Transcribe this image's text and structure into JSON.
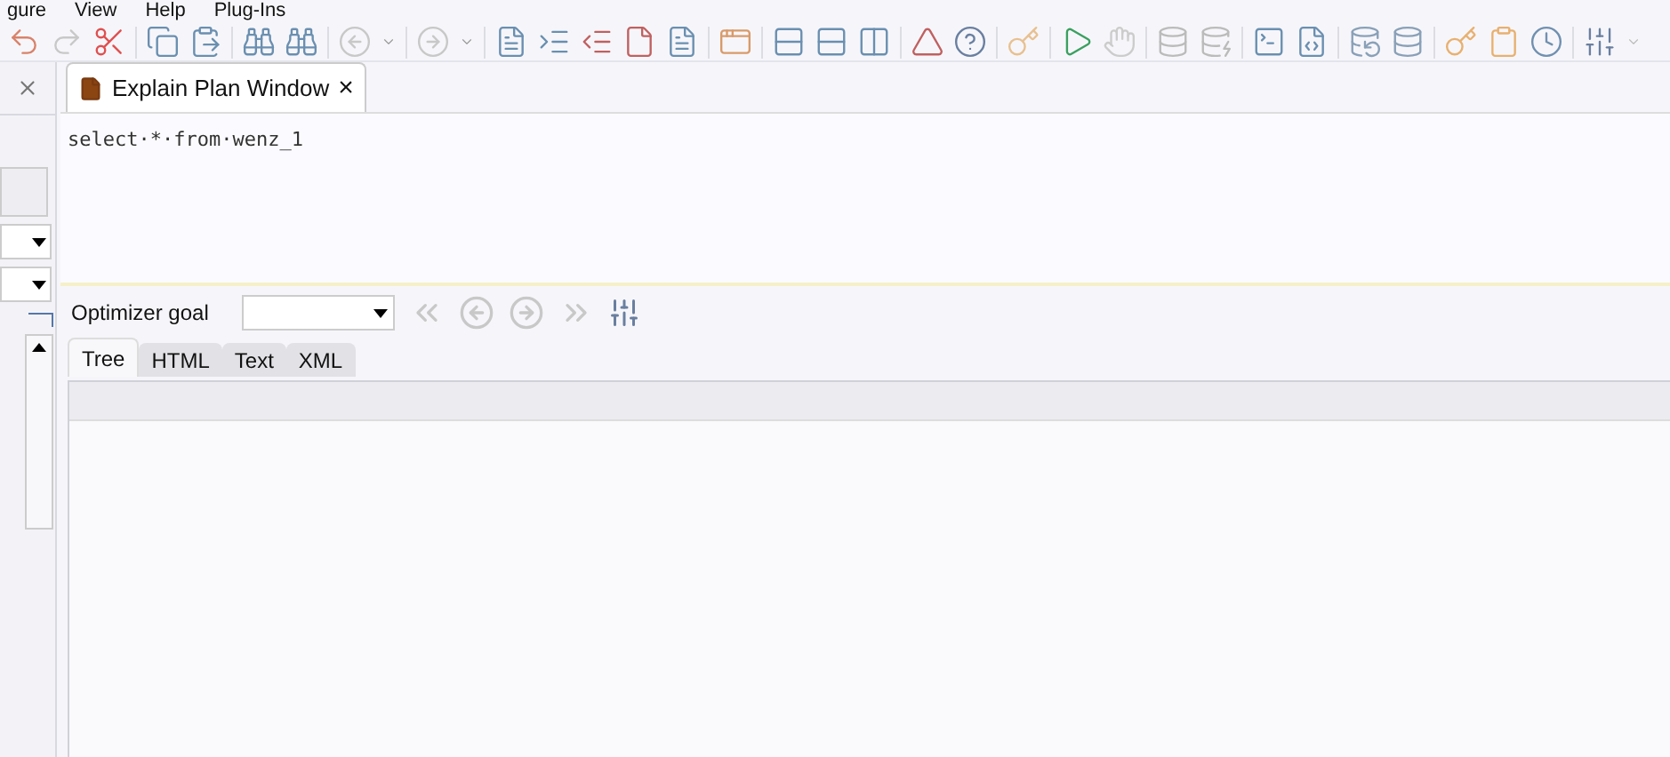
{
  "menu": [
    "gure",
    "View",
    "Help",
    "Plug-Ins"
  ],
  "editor_tab": {
    "title": "Explain Plan Window",
    "close": "×",
    "selected": true
  },
  "editor": {
    "value": "select·*·from·wenz_1"
  },
  "optimizer": {
    "label": "Optimizer goal"
  },
  "result_tabs": [
    {
      "label": "Tree",
      "selected": true
    },
    {
      "label": "HTML",
      "selected": false
    },
    {
      "label": "Text",
      "selected": false
    },
    {
      "label": "XML",
      "selected": false
    }
  ]
}
